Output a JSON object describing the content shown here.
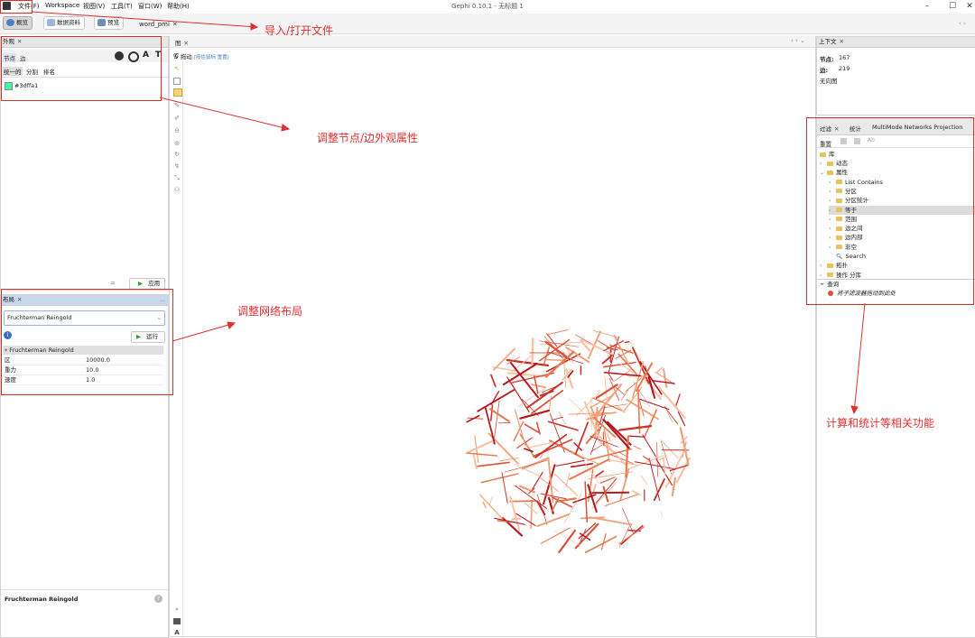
{
  "titlebar": {
    "title": "Gephi 0.10.1 - 无标题 1",
    "menu": [
      "文件(F)",
      "Workspace",
      "视图(V)",
      "工具(T)",
      "窗口(W)",
      "帮助(H)"
    ]
  },
  "toolbar": {
    "modes": [
      "概览",
      "数据资料",
      "预览"
    ],
    "workspace_tab": "word_pmi"
  },
  "appearance": {
    "title": "外观",
    "tabs": [
      "节点",
      "边"
    ],
    "subtabs": [
      "统一的",
      "分割",
      "排名"
    ],
    "color_value": "#3dffa1",
    "color": "#3dffa1",
    "apply_label": "应用"
  },
  "layout": {
    "title": "布局",
    "algorithm": "Fruchterman Reingold",
    "run_label": "运行",
    "section": "Fruchterman Reingold",
    "props": [
      {
        "name": "区",
        "value": "10000.0"
      },
      {
        "name": "重力",
        "value": "10.0"
      },
      {
        "name": "速度",
        "value": "1.0"
      }
    ],
    "footer_title": "Fruchterman Reingold"
  },
  "graph": {
    "title": "图",
    "drag_label": "拖动",
    "drag_hint": "(按住鼠标 重置)"
  },
  "context": {
    "title": "上下文",
    "nodes_label": "节点:",
    "nodes_value": "167",
    "edges_label": "边:",
    "edges_value": "219",
    "graph_type": "无向图"
  },
  "filters": {
    "tabs": [
      "过滤",
      "统计",
      "MultiMode Networks Projection"
    ],
    "reset_label": "重置",
    "library": "库",
    "tree": [
      {
        "label": "动态",
        "level": 0,
        "expanded": false
      },
      {
        "label": "属性",
        "level": 0,
        "expanded": true
      },
      {
        "label": "List Contains",
        "level": 1,
        "expanded": false
      },
      {
        "label": "分区",
        "level": 1,
        "expanded": false
      },
      {
        "label": "分区统计",
        "level": 1,
        "expanded": false
      },
      {
        "label": "等于",
        "level": 1,
        "expanded": false,
        "selected": true
      },
      {
        "label": "范围",
        "level": 1,
        "expanded": false
      },
      {
        "label": "边之间",
        "level": 1,
        "expanded": false
      },
      {
        "label": "边内部",
        "level": 1,
        "expanded": false
      },
      {
        "label": "非空",
        "level": 1,
        "expanded": false
      },
      {
        "label": "Search",
        "level": 1,
        "search": true
      },
      {
        "label": "拓扑",
        "level": 0,
        "expanded": false
      },
      {
        "label": "操作 分库",
        "level": 0,
        "expanded": false
      }
    ],
    "query_label": "查询",
    "drop_hint": "将子滤波器拖动到此处"
  },
  "annotations": {
    "import_open": "导入/打开文件",
    "adjust_appearance": "调整节点/边外观属性",
    "adjust_layout": "调整网络布局",
    "stats_functions": "计算和统计等相关功能",
    "color": "#e03030"
  }
}
